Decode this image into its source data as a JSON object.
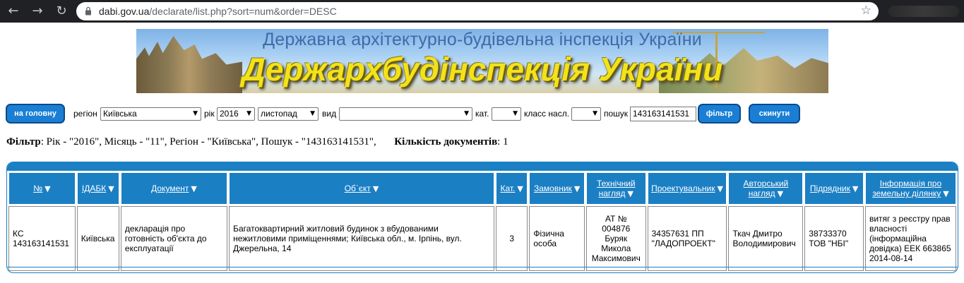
{
  "browser": {
    "url_host": "dabi.gov.ua",
    "url_path": "/declarate/list.php?sort=num&order=DESC"
  },
  "banner": {
    "top_text": "Державна архітектурно-будівельна інспекція України",
    "main_text": "Держархбудінспекція України"
  },
  "filters": {
    "home_button": "на головну",
    "region_label": "регіон",
    "region_value": "Київська",
    "year_label": "рік",
    "year_value": "2016",
    "month_value": "листопад",
    "kind_label": "вид",
    "kind_value": "",
    "cat_label": "кат.",
    "cat_value": "",
    "class_label": "класс насл.",
    "class_value": "",
    "search_label": "пошук",
    "search_value": "143163141531",
    "filter_button": "фільтр",
    "reset_button": "скинути"
  },
  "summary": {
    "filter_label": "Фільтр",
    "filter_text": ": Рік - \"2016\", Місяць - \"11\", Регіон - \"Київська\", Пошук - \"143163141531\",",
    "count_label": "Кількість документів",
    "count_text": ": 1"
  },
  "table": {
    "headers": {
      "num": "№",
      "idabk": "ІДАБК",
      "doc": "Документ",
      "object": "Об`єкт",
      "cat": "Кат.",
      "customer": "Замовник",
      "tech_1": "Технічний",
      "tech_2": "нагляд",
      "designer": "Проектувальник",
      "author_1": "Авторський",
      "author_2": "нагляд",
      "contractor": "Підрядник",
      "land_1": "Інформація про",
      "land_2": "земельну ділянку"
    },
    "row": {
      "num_1": "КС",
      "num_2": "143163141531",
      "idabk": "Київська",
      "doc": "декларація про готовність об'єкта до експлуатації",
      "object": "Багатоквартирний житловий будинок з вбудованими нежитловими приміщеннями; Київська обл., м. Ірпінь, вул. Джерельна, 14",
      "cat": "3",
      "customer": "Фізична особа",
      "tech": "АТ № 004876 Буряк Микола Максимович",
      "designer": "34357631 ПП \"ЛАДОПРОЕКТ\"",
      "author": "Ткач Дмитро Володимирович",
      "contractor": "38733370 ТОВ \"НБІ\"",
      "land": "витяг з реєстру прав власності (інформаційна довідка) ЕЕК 663865 2014-08-14"
    }
  }
}
